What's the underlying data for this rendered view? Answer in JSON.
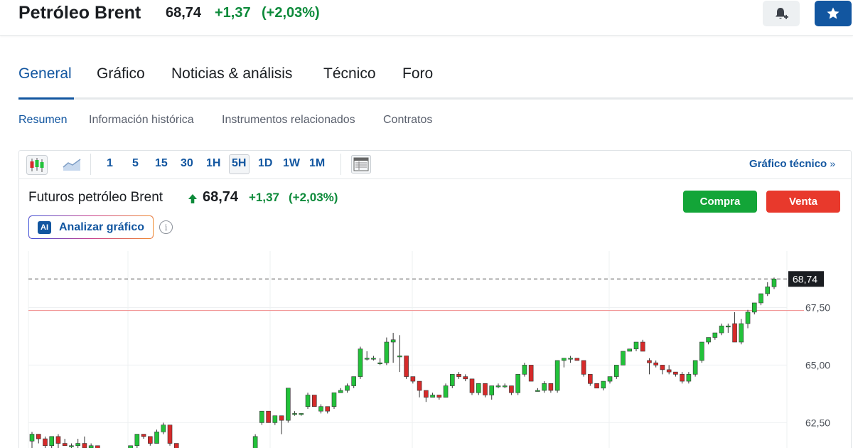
{
  "header": {
    "title": "Petróleo Brent",
    "price": "68,74",
    "change": "+1,37",
    "change_pct": "(+2,03%)",
    "alert_icon": "bell-plus-icon",
    "watchlist_icon": "star-icon"
  },
  "tabs": [
    {
      "label": "General",
      "active": true
    },
    {
      "label": "Gráfico",
      "active": false
    },
    {
      "label": "Noticias & análisis",
      "active": false
    },
    {
      "label": "Técnico",
      "active": false
    },
    {
      "label": "Foro",
      "active": false
    }
  ],
  "subtabs": [
    {
      "label": "Resumen",
      "active": true
    },
    {
      "label": "Información histórica",
      "active": false
    },
    {
      "label": "Instrumentos relacionados",
      "active": false
    },
    {
      "label": "Contratos",
      "active": false
    }
  ],
  "toolbar": {
    "chart_type_icons": [
      "candlestick-icon",
      "area-chart-icon"
    ],
    "timeframes": [
      "1",
      "5",
      "15",
      "30",
      "1H",
      "5H",
      "1D",
      "1W",
      "1M"
    ],
    "selected_timeframe": "5H",
    "table_icon": "table-view-icon",
    "technical_link": "Gráfico técnico",
    "technical_link_chevron": "»"
  },
  "instrument": {
    "name": "Futuros petróleo Brent",
    "direction_icon": "arrow-up-icon",
    "price": "68,74",
    "change": "+1,37",
    "change_pct": "(+2,03%)"
  },
  "actions": {
    "buy": "Compra",
    "sell": "Venta",
    "ai_badge": "AI",
    "ai_label": "Analizar gráfico",
    "info_icon": "i"
  },
  "colors": {
    "accent": "#1256a0",
    "up": "#0d8a3a",
    "candle_up": "#22c23a",
    "candle_down": "#d62a2a",
    "buy": "#13a538",
    "sell": "#e8392c"
  },
  "chart_data": {
    "type": "candlestick",
    "interval": "5H",
    "y_tick_labels": [
      "68,74",
      "67,50",
      "65,00",
      "62,50"
    ],
    "y_ticks": [
      67.5,
      65.0,
      62.5
    ],
    "ylim": [
      61.4,
      70.2
    ],
    "last_price": 68.74,
    "last_price_label": "68,74",
    "previous_close_line": 67.37,
    "grid": true,
    "candles": [
      [
        61.7,
        62.1,
        61.4,
        62.0
      ],
      [
        62.0,
        62.0,
        61.6,
        61.8
      ],
      [
        61.8,
        61.9,
        61.4,
        61.5
      ],
      [
        61.5,
        61.9,
        61.4,
        61.9
      ],
      [
        61.9,
        62.0,
        61.4,
        61.6
      ],
      [
        61.6,
        61.8,
        61.5,
        61.5
      ],
      [
        61.5,
        61.6,
        61.4,
        61.5
      ],
      [
        61.5,
        61.8,
        61.4,
        61.6
      ],
      [
        61.6,
        61.9,
        61.3,
        61.4
      ],
      [
        61.4,
        61.6,
        61.3,
        61.5
      ],
      [
        61.5,
        61.5,
        61.0,
        61.1
      ],
      [
        61.1,
        61.4,
        61.0,
        61.3
      ],
      [
        61.3,
        61.3,
        60.9,
        61.0
      ],
      [
        61.0,
        61.1,
        60.9,
        61.0
      ],
      [
        61.0,
        61.2,
        60.9,
        61.1
      ],
      [
        61.1,
        61.5,
        61.0,
        61.5
      ],
      [
        61.5,
        62.0,
        61.4,
        62.0
      ],
      [
        62.0,
        62.0,
        61.8,
        61.9
      ],
      [
        61.9,
        61.9,
        61.5,
        61.6
      ],
      [
        61.6,
        62.2,
        61.6,
        62.1
      ],
      [
        62.1,
        62.5,
        62.0,
        62.4
      ],
      [
        62.4,
        62.4,
        61.5,
        61.6
      ],
      [
        61.6,
        61.6,
        61.2,
        61.3
      ],
      [
        61.3,
        61.4,
        61.1,
        61.3
      ],
      [
        61.3,
        61.3,
        61.0,
        61.1
      ],
      [
        61.1,
        61.2,
        60.9,
        61.1
      ],
      [
        61.1,
        61.2,
        61.0,
        61.2
      ],
      [
        61.2,
        61.2,
        60.9,
        61.0
      ],
      [
        61.0,
        61.1,
        60.9,
        61.0
      ],
      [
        61.0,
        61.4,
        61.0,
        61.3
      ],
      [
        61.3,
        61.4,
        61.1,
        61.2
      ],
      [
        61.2,
        61.4,
        61.1,
        61.3
      ],
      [
        61.3,
        61.4,
        61.2,
        61.3
      ],
      [
        61.3,
        61.4,
        61.2,
        61.3
      ],
      [
        61.3,
        62.0,
        61.3,
        61.9
      ],
      [
        62.5,
        63.0,
        62.4,
        63.0
      ],
      [
        63.0,
        63.0,
        62.5,
        62.5
      ],
      [
        62.5,
        62.8,
        62.4,
        62.8
      ],
      [
        62.8,
        62.8,
        62.0,
        62.6
      ],
      [
        62.6,
        64.0,
        62.5,
        64.0
      ],
      [
        62.9,
        63.0,
        62.8,
        62.9
      ],
      [
        62.9,
        62.9,
        62.8,
        62.9
      ],
      [
        63.2,
        63.8,
        63.1,
        63.7
      ],
      [
        63.7,
        63.7,
        63.2,
        63.2
      ],
      [
        63.0,
        63.3,
        62.9,
        63.2
      ],
      [
        63.2,
        63.2,
        62.9,
        63.0
      ],
      [
        63.2,
        63.8,
        63.1,
        63.8
      ],
      [
        63.8,
        64.0,
        63.8,
        63.9
      ],
      [
        63.9,
        64.2,
        63.8,
        64.1
      ],
      [
        64.1,
        64.5,
        64.0,
        64.5
      ],
      [
        64.5,
        65.8,
        64.4,
        65.7
      ],
      [
        65.3,
        65.6,
        65.2,
        65.3
      ],
      [
        65.3,
        65.4,
        65.2,
        65.3
      ],
      [
        65.1,
        65.3,
        65.0,
        65.1
      ],
      [
        65.1,
        66.2,
        65.0,
        66.0
      ],
      [
        66.0,
        66.4,
        65.1,
        66.1
      ],
      [
        65.4,
        66.3,
        64.7,
        65.4
      ],
      [
        65.4,
        65.4,
        64.4,
        64.5
      ],
      [
        64.5,
        64.5,
        64.2,
        64.3
      ],
      [
        64.3,
        64.3,
        63.6,
        63.9
      ],
      [
        63.9,
        63.9,
        63.4,
        63.6
      ],
      [
        63.6,
        63.8,
        63.6,
        63.7
      ],
      [
        63.7,
        63.7,
        63.5,
        63.6
      ],
      [
        63.6,
        64.2,
        63.6,
        64.1
      ],
      [
        64.1,
        64.6,
        64.0,
        64.6
      ],
      [
        64.6,
        64.7,
        64.4,
        64.5
      ],
      [
        64.5,
        64.6,
        64.3,
        64.4
      ],
      [
        64.4,
        64.4,
        63.7,
        63.8
      ],
      [
        63.8,
        64.2,
        63.7,
        64.2
      ],
      [
        64.2,
        64.2,
        63.6,
        63.7
      ],
      [
        63.7,
        64.1,
        63.5,
        64.1
      ],
      [
        64.1,
        64.2,
        64.0,
        64.1
      ],
      [
        64.1,
        64.2,
        64.0,
        64.1
      ],
      [
        64.1,
        64.1,
        63.7,
        63.8
      ],
      [
        63.8,
        64.6,
        63.7,
        64.6
      ],
      [
        64.6,
        65.1,
        64.5,
        65.0
      ],
      [
        65.0,
        65.0,
        64.3,
        64.3
      ],
      [
        63.9,
        64.0,
        63.9,
        63.9
      ],
      [
        63.9,
        64.3,
        63.8,
        64.2
      ],
      [
        64.2,
        64.2,
        63.8,
        63.9
      ],
      [
        63.9,
        65.2,
        63.8,
        65.2
      ],
      [
        65.2,
        65.3,
        64.9,
        65.3
      ],
      [
        65.3,
        65.4,
        65.1,
        65.3
      ],
      [
        65.3,
        65.3,
        65.2,
        65.2
      ],
      [
        65.2,
        65.2,
        64.5,
        64.6
      ],
      [
        64.6,
        64.6,
        64.1,
        64.2
      ],
      [
        64.2,
        64.2,
        64.0,
        64.0
      ],
      [
        64.0,
        64.3,
        63.9,
        64.3
      ],
      [
        64.3,
        64.5,
        64.2,
        64.5
      ],
      [
        64.5,
        65.0,
        64.4,
        65.0
      ],
      [
        65.0,
        65.6,
        65.0,
        65.6
      ],
      [
        65.6,
        65.7,
        65.6,
        65.7
      ],
      [
        65.7,
        66.0,
        65.6,
        66.0
      ],
      [
        66.0,
        66.1,
        65.6,
        65.6
      ],
      [
        65.2,
        65.3,
        64.6,
        65.1
      ],
      [
        65.1,
        65.2,
        64.9,
        65.0
      ],
      [
        65.0,
        65.0,
        64.6,
        64.8
      ],
      [
        64.8,
        65.0,
        64.6,
        64.7
      ],
      [
        64.7,
        64.7,
        64.5,
        64.6
      ],
      [
        64.6,
        64.7,
        64.2,
        64.3
      ],
      [
        64.3,
        64.7,
        64.2,
        64.6
      ],
      [
        64.6,
        65.2,
        64.5,
        65.2
      ],
      [
        65.2,
        66.0,
        65.1,
        66.0
      ],
      [
        66.0,
        66.2,
        65.9,
        66.2
      ],
      [
        66.2,
        66.4,
        66.1,
        66.4
      ],
      [
        66.4,
        66.8,
        66.3,
        66.7
      ],
      [
        66.7,
        66.8,
        66.4,
        66.7
      ],
      [
        66.8,
        67.3,
        66.0,
        66.0
      ],
      [
        66.0,
        67.0,
        65.9,
        66.8
      ],
      [
        66.8,
        67.4,
        66.6,
        67.3
      ],
      [
        67.3,
        67.7,
        67.2,
        67.7
      ],
      [
        67.7,
        68.1,
        67.6,
        68.1
      ],
      [
        68.1,
        68.6,
        68.0,
        68.4
      ],
      [
        68.4,
        68.8,
        68.3,
        68.74
      ]
    ]
  }
}
